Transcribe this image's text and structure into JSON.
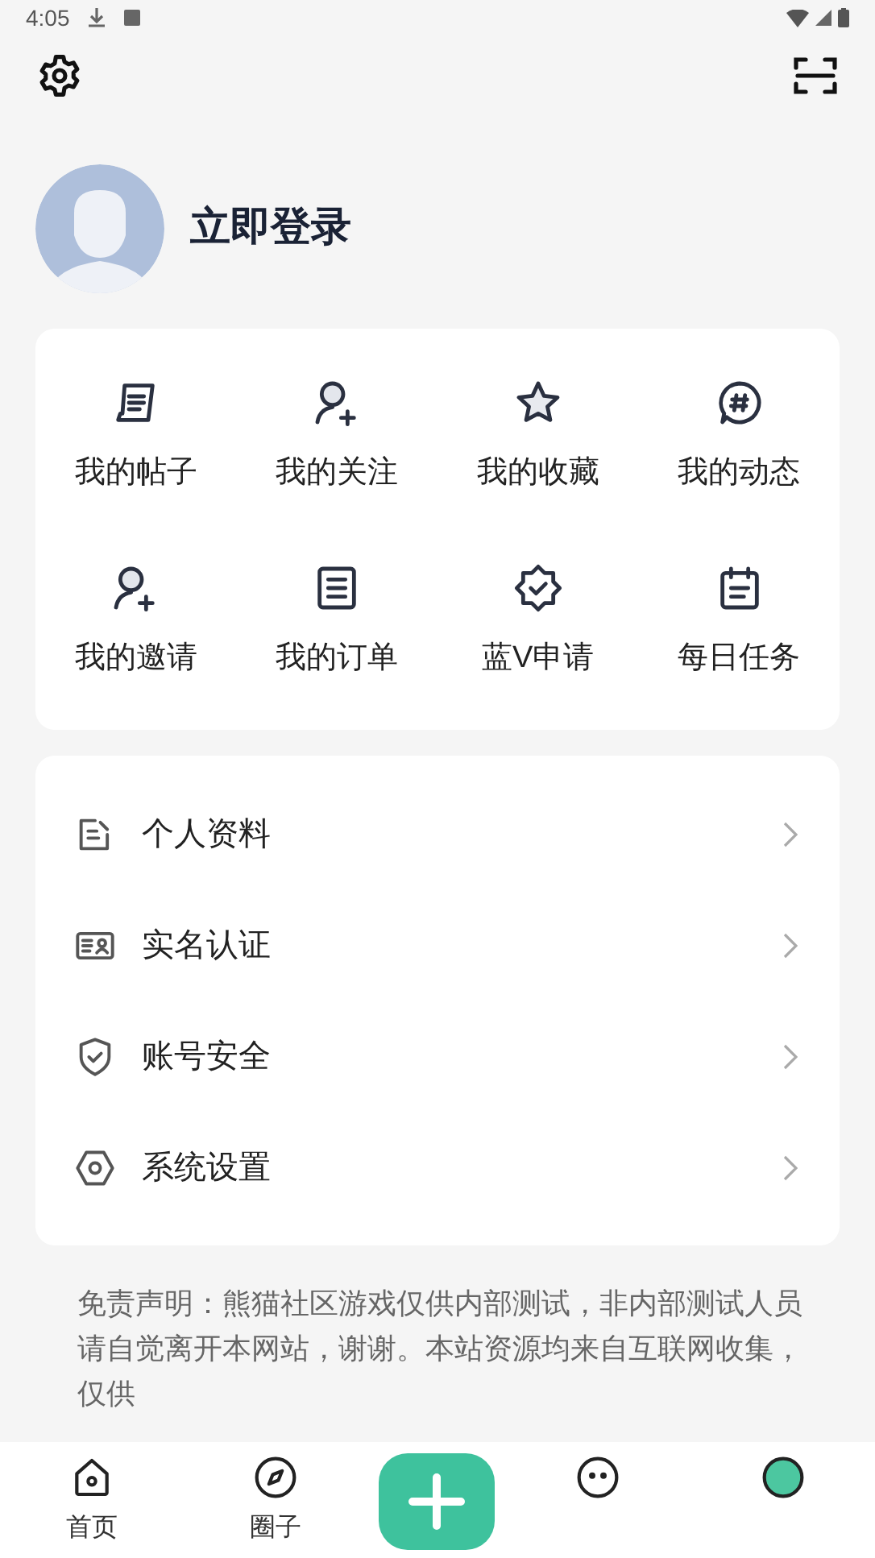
{
  "status_bar": {
    "time": "4:05"
  },
  "profile": {
    "login_label": "立即登录"
  },
  "shortcuts": [
    {
      "kind": "post",
      "label": "我的帖子"
    },
    {
      "kind": "follow",
      "label": "我的关注"
    },
    {
      "kind": "star",
      "label": "我的收藏"
    },
    {
      "kind": "hash",
      "label": "我的动态"
    },
    {
      "kind": "invite",
      "label": "我的邀请"
    },
    {
      "kind": "order",
      "label": "我的订单"
    },
    {
      "kind": "badge",
      "label": "蓝V申请"
    },
    {
      "kind": "calendar",
      "label": "每日任务"
    }
  ],
  "menu": [
    {
      "kind": "edit",
      "label": "个人资料"
    },
    {
      "kind": "idcard",
      "label": "实名认证"
    },
    {
      "kind": "shield",
      "label": "账号安全"
    },
    {
      "kind": "hexagon",
      "label": "系统设置"
    }
  ],
  "disclaimer": "免责声明：熊猫社区游戏仅供内部测试，非内部测试人员请自觉离开本网站，谢谢。本站资源均来自互联网收集，仅供",
  "bottom_nav": [
    {
      "kind": "home",
      "label": "首页"
    },
    {
      "kind": "compass",
      "label": "圈子"
    },
    {
      "kind": "add"
    },
    {
      "kind": "face"
    },
    {
      "kind": "avatar"
    }
  ]
}
